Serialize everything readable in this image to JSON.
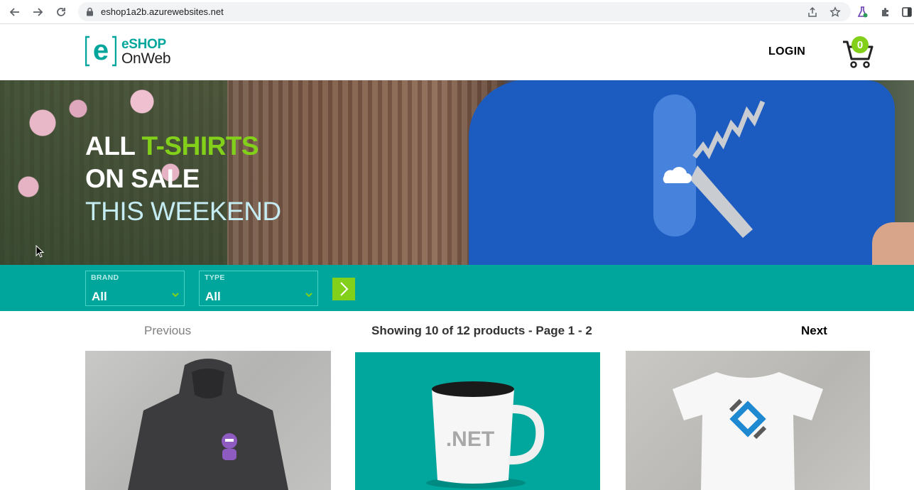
{
  "browser": {
    "url": "eshop1a2b.azurewebsites.net",
    "icons": [
      "back-icon",
      "forward-icon",
      "reload-icon",
      "lock-icon",
      "share-icon",
      "star-icon",
      "flask-icon",
      "extensions-icon",
      "sidebar-icon"
    ]
  },
  "header": {
    "logo_line1": "eSHOP",
    "logo_line2": "OnWeb",
    "login": "LOGIN",
    "cart_count": "0"
  },
  "hero": {
    "line1_white": "ALL ",
    "line1_accent": "T-SHIRTS",
    "line2": "ON SALE",
    "line3": "THIS WEEKEND"
  },
  "filters": {
    "brand": {
      "label": "BRAND",
      "value": "All"
    },
    "type": {
      "label": "TYPE",
      "value": "All"
    }
  },
  "pager": {
    "previous": "Previous",
    "info": "Showing 10 of 12 products - Page 1 - 2",
    "next": "Next"
  },
  "products": [
    {
      "image": "hoodie-with-robot",
      "mug_text": ""
    },
    {
      "image": "net-mug",
      "mug_text": ".NET"
    },
    {
      "image": "white-tshirt-logo",
      "mug_text": ""
    }
  ],
  "colors": {
    "teal": "#00a69c",
    "green": "#83d01b",
    "shirt_blue": "#1c5bbf"
  }
}
